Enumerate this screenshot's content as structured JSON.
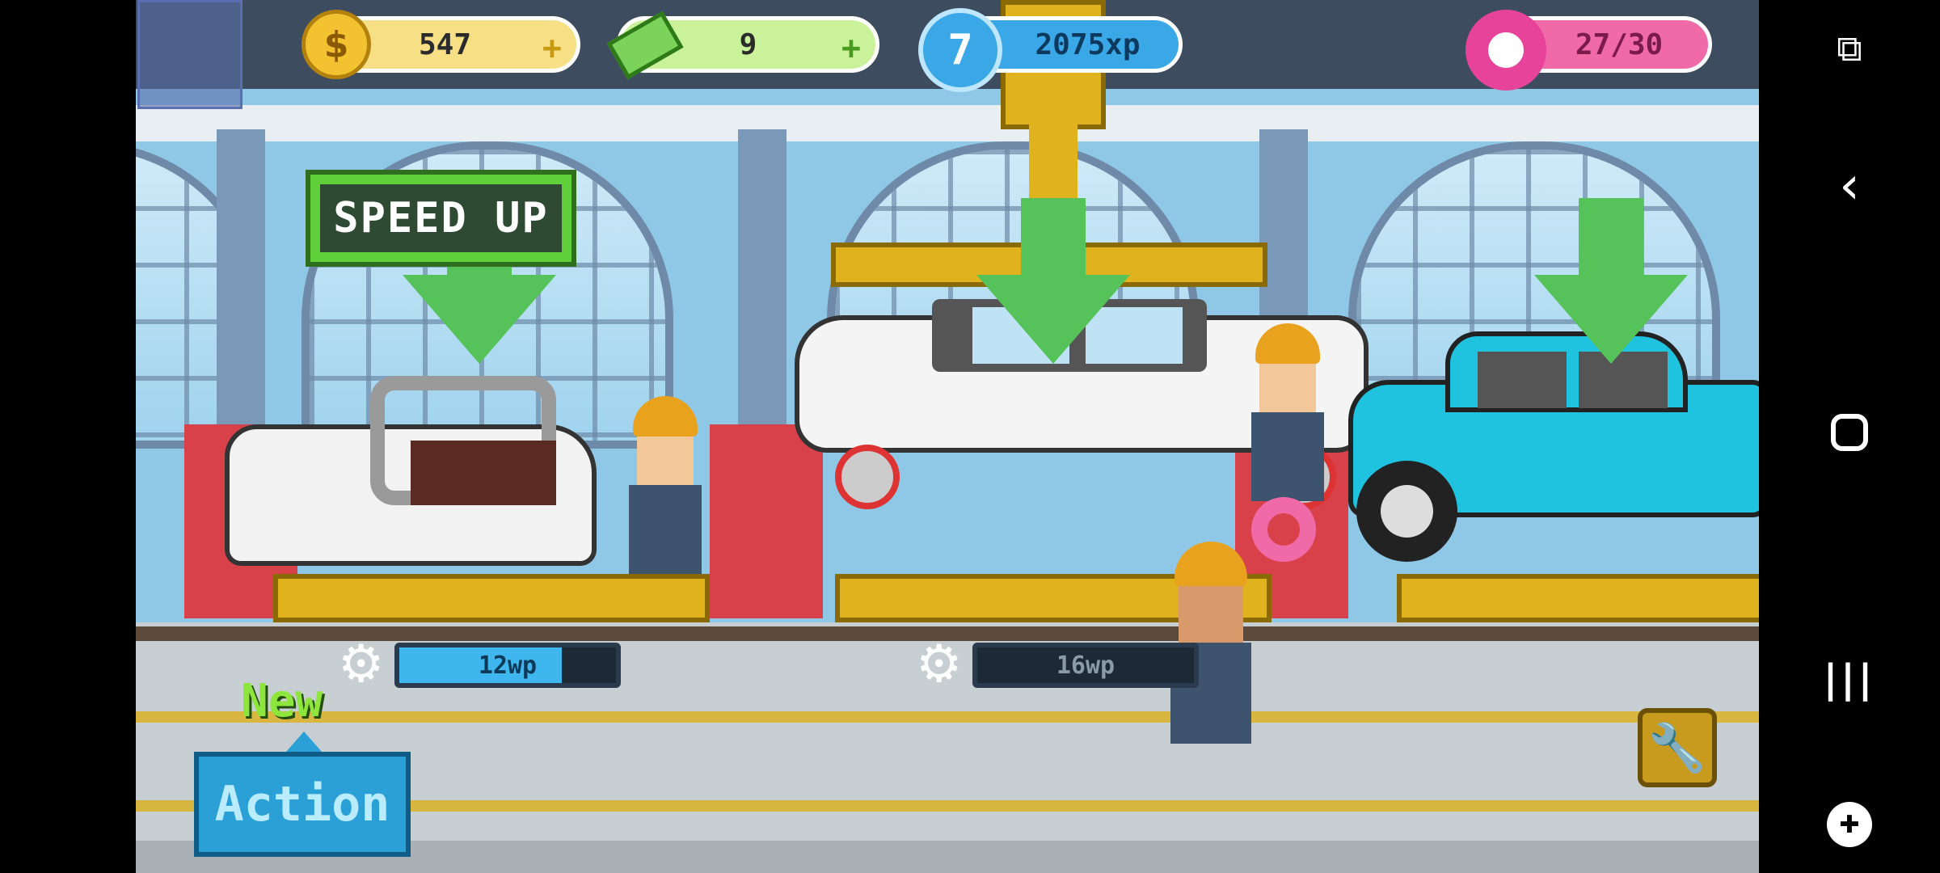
{
  "hud": {
    "coins": "547",
    "cash": "9",
    "level": "7",
    "xp": "2075xp",
    "donuts": "27/30",
    "plus": "+"
  },
  "speed_up_label": "SPEED UP",
  "stations": [
    {
      "wp": "12wp",
      "progress": 0.75
    },
    {
      "wp": "16wp",
      "progress": 0.0
    }
  ],
  "new_label": "New",
  "action_label": "Action",
  "colors": {
    "gold": "#f2c230",
    "green": "#7bd35b",
    "blue": "#3aa8e6",
    "pink": "#e8439a",
    "speedup_green": "#5fcf3a"
  },
  "icons": {
    "coin": "dollar-coin-icon",
    "cash": "cash-icon",
    "xp": "plane-icon",
    "donut": "donut-icon",
    "wrench": "wrench-icon",
    "gear": "gear-icon"
  }
}
